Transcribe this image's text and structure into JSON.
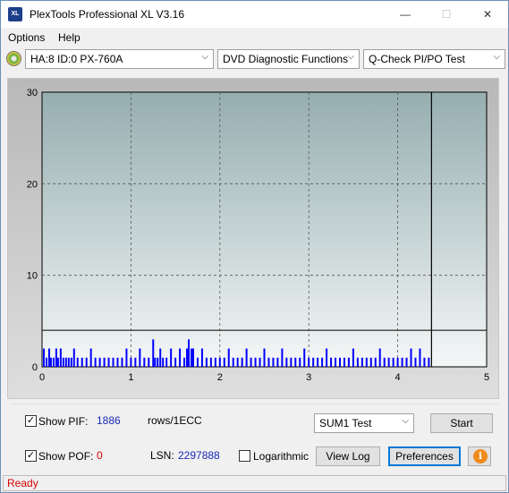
{
  "window": {
    "title": "PlexTools Professional XL V3.16",
    "icon_text": "XL",
    "minimize_glyph": "—",
    "maximize_glyph": "☐",
    "close_glyph": "✕"
  },
  "menu": {
    "options": "Options",
    "help": "Help"
  },
  "toolbar": {
    "drive": "HA:8 ID:0  PX-760A",
    "function": "DVD Diagnostic Functions",
    "test": "Q-Check PI/PO Test",
    "arrow_glyph": "⌵"
  },
  "chart_data": {
    "type": "bar",
    "xlim": [
      0,
      5
    ],
    "ylim": [
      0,
      30
    ],
    "x_ticks": [
      0,
      1,
      2,
      3,
      4,
      5
    ],
    "y_ticks": [
      0,
      10,
      20,
      30
    ],
    "grid": true,
    "threshold": 4,
    "end_marker_x": 4.38,
    "series": [
      {
        "color": "#0000ff",
        "x": [
          0.02,
          0.05,
          0.08,
          0.1,
          0.13,
          0.16,
          0.18,
          0.21,
          0.24,
          0.27,
          0.3,
          0.33,
          0.36,
          0.4,
          0.45,
          0.5,
          0.55,
          0.6,
          0.65,
          0.7,
          0.75,
          0.8,
          0.85,
          0.9,
          0.95,
          1.0,
          1.05,
          1.1,
          1.15,
          1.2,
          1.25,
          1.27,
          1.3,
          1.33,
          1.36,
          1.4,
          1.45,
          1.5,
          1.55,
          1.6,
          1.63,
          1.65,
          1.68,
          1.7,
          1.75,
          1.8,
          1.85,
          1.9,
          1.95,
          2.0,
          2.05,
          2.1,
          2.15,
          2.2,
          2.25,
          2.3,
          2.35,
          2.4,
          2.45,
          2.5,
          2.55,
          2.6,
          2.65,
          2.7,
          2.75,
          2.8,
          2.85,
          2.9,
          2.95,
          3.0,
          3.05,
          3.1,
          3.15,
          3.2,
          3.25,
          3.3,
          3.35,
          3.4,
          3.45,
          3.5,
          3.55,
          3.6,
          3.65,
          3.7,
          3.75,
          3.8,
          3.85,
          3.9,
          3.95,
          4.0,
          4.05,
          4.1,
          4.15,
          4.2,
          4.25,
          4.3,
          4.35
        ],
        "y": [
          2,
          1,
          2,
          1,
          1,
          2,
          1,
          2,
          1,
          1,
          1,
          1,
          2,
          1,
          1,
          1,
          2,
          1,
          1,
          1,
          1,
          1,
          1,
          1,
          2,
          1,
          1,
          2,
          1,
          1,
          3,
          1,
          1,
          2,
          1,
          1,
          2,
          1,
          2,
          1,
          2,
          3,
          2,
          2,
          1,
          2,
          1,
          1,
          1,
          1,
          1,
          2,
          1,
          1,
          1,
          2,
          1,
          1,
          1,
          2,
          1,
          1,
          1,
          2,
          1,
          1,
          1,
          1,
          2,
          1,
          1,
          1,
          1,
          2,
          1,
          1,
          1,
          1,
          1,
          2,
          1,
          1,
          1,
          1,
          1,
          2,
          1,
          1,
          1,
          1,
          1,
          1,
          2,
          1,
          2,
          1,
          1
        ]
      }
    ]
  },
  "controls": {
    "show_pif_label": "Show PIF:",
    "show_pif_checked": "✓",
    "pif_value": "1886",
    "pif_unit": "rows/1ECC",
    "show_pof_label": "Show POF:",
    "show_pof_checked": "✓",
    "pof_value": "0",
    "lsn_label": "LSN:",
    "lsn_value": "2297888",
    "logarithmic_label": "Logarithmic",
    "sum_select": "SUM1 Test",
    "start_button": "Start",
    "view_log_button": "View Log",
    "preferences_button": "Preferences",
    "info_glyph": "i"
  },
  "status": {
    "text": "Ready"
  }
}
